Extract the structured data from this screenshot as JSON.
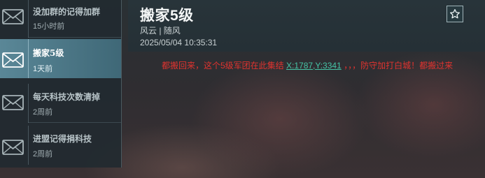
{
  "mail_list": [
    {
      "title": "没加群的记得加群",
      "time": "15小时前",
      "active": false
    },
    {
      "title": "搬家5级",
      "time": "1天前",
      "active": true
    },
    {
      "title": "每天科技次数清掉",
      "time": "2周前",
      "active": false
    },
    {
      "title": "进盟记得捐科技",
      "time": "2周前",
      "active": false
    }
  ],
  "detail": {
    "subject": "搬家5级",
    "sender": "风云 | 随风",
    "date": "2025/05/04  10:35:31",
    "body_before": "都搬回来，这个5级军团在此集结 ",
    "coord_link": "X:1787,Y:3341",
    "body_after": " ，，，防守加打白城！都搬过来"
  },
  "icons": {
    "mail": "envelope-icon",
    "favorite": "star-icon"
  },
  "colors": {
    "body_text": "#e0332f",
    "link": "#46c4a6",
    "active_item": "#5a8797"
  }
}
